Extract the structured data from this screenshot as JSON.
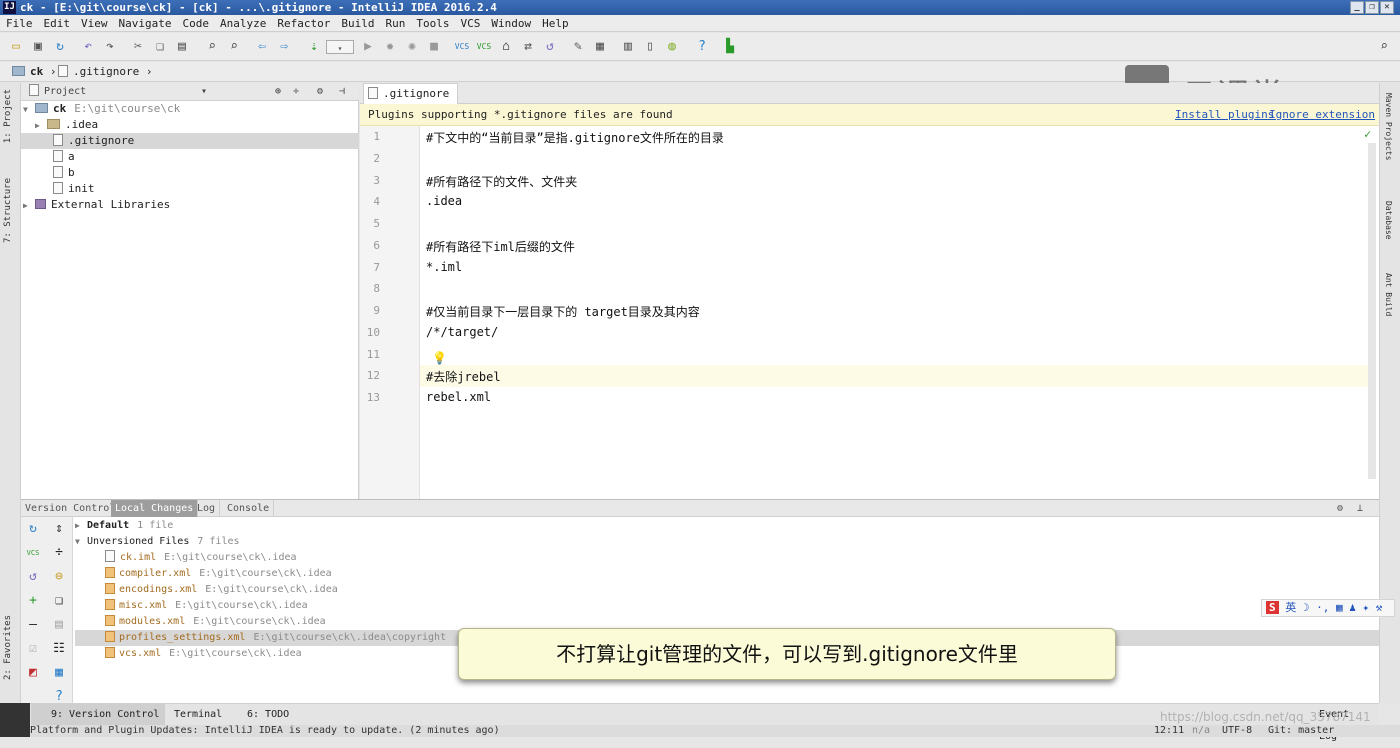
{
  "window": {
    "title": "ck - [E:\\git\\course\\ck] - [ck] - ...\\.gitignore - IntelliJ IDEA 2016.2.4",
    "app_icon": "IJ"
  },
  "menu": [
    "File",
    "Edit",
    "View",
    "Navigate",
    "Code",
    "Analyze",
    "Refactor",
    "Build",
    "Run",
    "Tools",
    "VCS",
    "Window",
    "Help"
  ],
  "nav": {
    "crumbs": [
      "ck",
      ".gitignore"
    ]
  },
  "left_tool": {
    "project": "1: Project",
    "structure": "7: Structure",
    "favorites": "2: Favorites"
  },
  "right_tool": {
    "maven": "Maven Projects",
    "database": "Database",
    "ant": "Ant Build"
  },
  "project_panel": {
    "title": "Project",
    "tree": [
      {
        "name": "ck",
        "path": "E:\\git\\course\\ck",
        "type": "module",
        "expanded": true
      },
      {
        "name": ".idea",
        "type": "folder"
      },
      {
        "name": ".gitignore",
        "type": "file",
        "selected": true
      },
      {
        "name": "a",
        "type": "file"
      },
      {
        "name": "b",
        "type": "file"
      },
      {
        "name": "init",
        "type": "file"
      },
      {
        "name": "External Libraries",
        "type": "library"
      }
    ]
  },
  "editor": {
    "tab": ".gitignore",
    "banner": {
      "text": "Plugins supporting *.gitignore files are found",
      "install": "Install plugins",
      "ignore": "Ignore extension"
    },
    "lines": [
      "#下文中的“当前目录”是指.gitignore文件所在的目录",
      "",
      "#所有路径下的文件、文件夹",
      ".idea",
      "",
      "#所有路径下iml后缀的文件",
      "*.iml",
      "",
      "#仅当前目录下一层目录下的 target目录及其内容",
      "/*/target/",
      "",
      "#去除jrebel",
      "rebel.xml"
    ],
    "current_line": 12
  },
  "watermark": "云课堂",
  "version_control": {
    "tabs": [
      "Version Control:",
      "Local Changes",
      "Log",
      "Console"
    ],
    "active_tab": "Local Changes",
    "default_list": {
      "name": "Default",
      "count": "1 file"
    },
    "unversioned": {
      "name": "Unversioned Files",
      "count": "7 files"
    },
    "files": [
      {
        "name": "ck.iml",
        "path": "E:\\git\\course\\ck\\.idea"
      },
      {
        "name": "compiler.xml",
        "path": "E:\\git\\course\\ck\\.idea"
      },
      {
        "name": "encodings.xml",
        "path": "E:\\git\\course\\ck\\.idea"
      },
      {
        "name": "misc.xml",
        "path": "E:\\git\\course\\ck\\.idea"
      },
      {
        "name": "modules.xml",
        "path": "E:\\git\\course\\ck\\.idea"
      },
      {
        "name": "profiles_settings.xml",
        "path": "E:\\git\\course\\ck\\.idea\\copyright",
        "selected": true
      },
      {
        "name": "vcs.xml",
        "path": "E:\\git\\course\\ck\\.idea"
      }
    ]
  },
  "bottom_tabs": [
    "9: Version Control",
    "Terminal",
    "6: TODO",
    "Event Log"
  ],
  "status": {
    "message": "Platform and Plugin Updates: IntelliJ IDEA is ready to update. (2 minutes ago)",
    "position": "12:11",
    "na": "n/a",
    "encoding": "UTF-8",
    "git": "Git: master"
  },
  "tooltip": "不打算让git管理的文件，可以写到.gitignore文件里",
  "ime": "英",
  "csdn": "https://blog.csdn.net/qq_35787141"
}
